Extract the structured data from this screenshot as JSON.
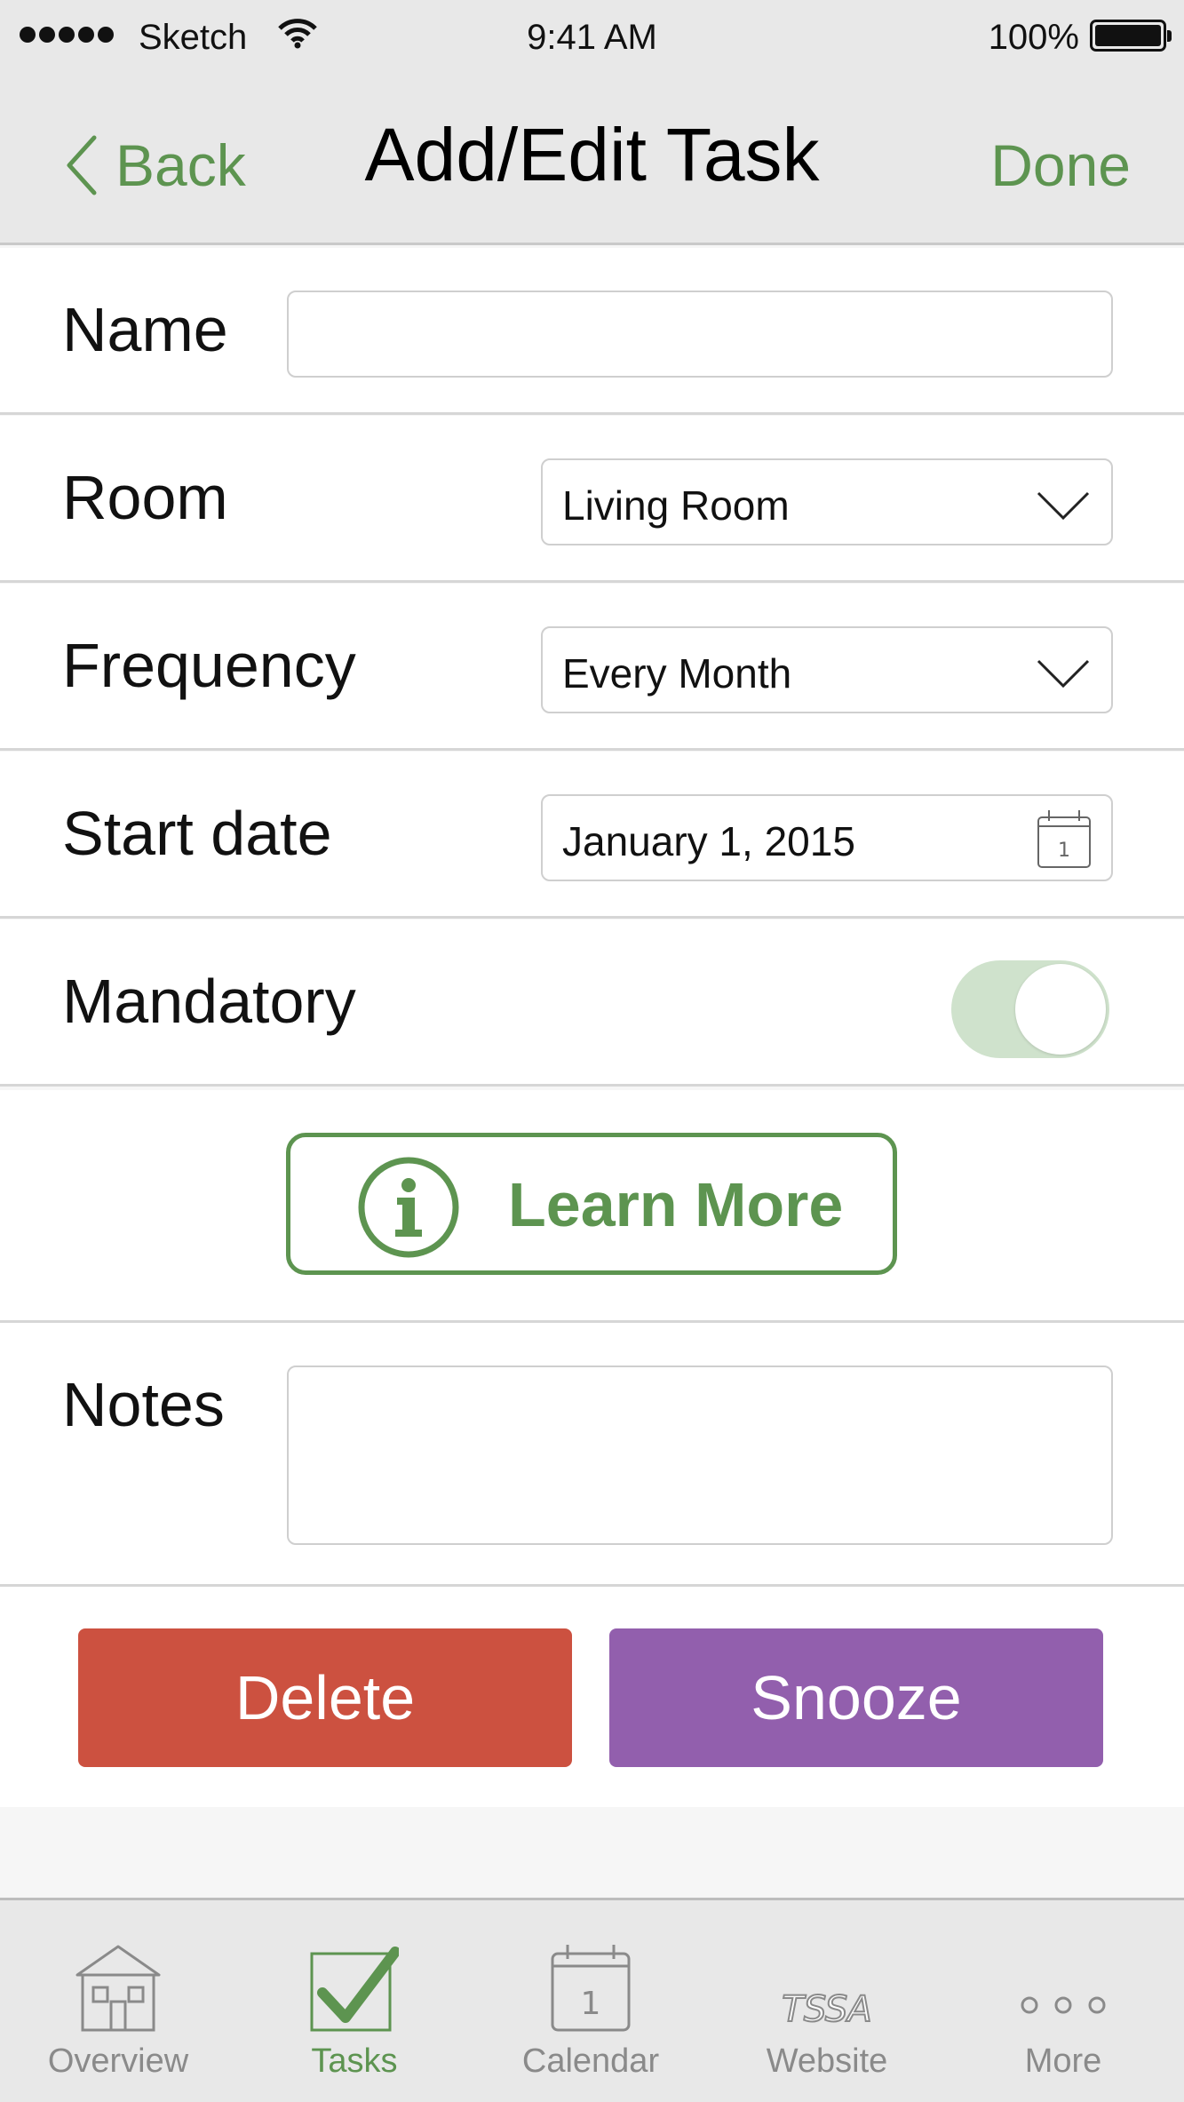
{
  "status_bar": {
    "carrier": "Sketch",
    "time": "9:41 AM",
    "battery": "100%"
  },
  "nav": {
    "back_label": "Back",
    "title": "Add/Edit Task",
    "done_label": "Done"
  },
  "form": {
    "name": {
      "label": "Name",
      "value": ""
    },
    "room": {
      "label": "Room",
      "value": "Living Room"
    },
    "frequency": {
      "label": "Frequency",
      "value": "Every Month"
    },
    "start_date": {
      "label": "Start date",
      "value": "January 1, 2015",
      "calendar_day": "1"
    },
    "mandatory": {
      "label": "Mandatory",
      "on": false
    }
  },
  "learn_more": {
    "label": "Learn More"
  },
  "notes": {
    "label": "Notes",
    "value": ""
  },
  "actions": {
    "delete_label": "Delete",
    "snooze_label": "Snooze"
  },
  "tabs": [
    {
      "label": "Overview",
      "icon": "house-icon",
      "active": false
    },
    {
      "label": "Tasks",
      "icon": "checkbox-icon",
      "active": true
    },
    {
      "label": "Calendar",
      "icon": "calendar-icon",
      "active": false,
      "icon_text": "1"
    },
    {
      "label": "Website",
      "icon": "tssa-logo-icon",
      "active": false,
      "icon_text": "TSSA"
    },
    {
      "label": "More",
      "icon": "more-icon",
      "active": false
    }
  ],
  "colors": {
    "accent_green": "#5d9450",
    "delete_red": "#cc5140",
    "snooze_purple": "#925fad",
    "bar_gray": "#e8e8e8"
  }
}
